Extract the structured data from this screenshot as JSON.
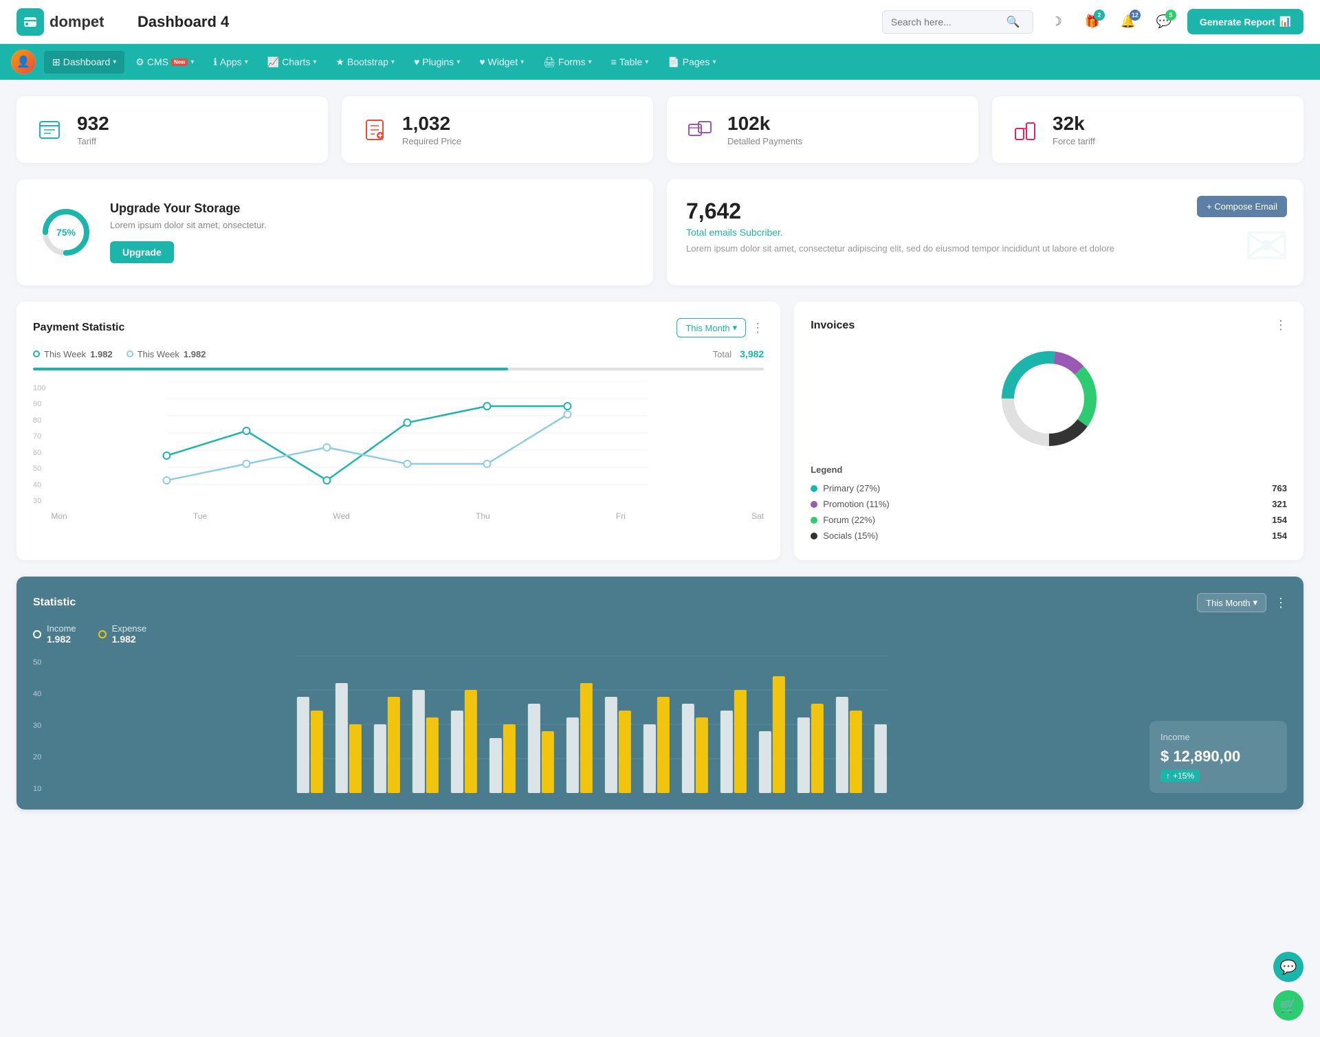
{
  "app": {
    "logo_letter": "c",
    "logo_name": "dompet",
    "page_title": "Dashboard 4",
    "search_placeholder": "Search here...",
    "generate_btn": "Generate Report"
  },
  "header_icons": {
    "moon_icon": "☽",
    "gift_icon": "🎁",
    "gift_badge": "2",
    "bell_icon": "🔔",
    "bell_badge": "12",
    "message_icon": "💬",
    "message_badge": "5"
  },
  "nav": {
    "items": [
      {
        "label": "Dashboard",
        "active": true,
        "has_arrow": true
      },
      {
        "label": "CMS",
        "has_badge_new": true,
        "has_arrow": true
      },
      {
        "label": "Apps",
        "has_arrow": true
      },
      {
        "label": "Charts",
        "has_arrow": true
      },
      {
        "label": "Bootstrap",
        "has_arrow": true
      },
      {
        "label": "Plugins",
        "has_arrow": true
      },
      {
        "label": "Widget",
        "has_arrow": true
      },
      {
        "label": "Forms",
        "has_arrow": true
      },
      {
        "label": "Table",
        "has_arrow": true
      },
      {
        "label": "Pages",
        "has_arrow": true
      }
    ]
  },
  "stat_cards": [
    {
      "number": "932",
      "label": "Tariff",
      "icon": "🗂️",
      "color": "#1cb5ac"
    },
    {
      "number": "1,032",
      "label": "Required Price",
      "icon": "📄",
      "color": "#e74c3c"
    },
    {
      "number": "102k",
      "label": "Detalled Payments",
      "icon": "🏪",
      "color": "#9b59b6"
    },
    {
      "number": "32k",
      "label": "Force tariff",
      "icon": "🏢",
      "color": "#e91e63"
    }
  ],
  "storage": {
    "percent": 75,
    "title": "Upgrade Your Storage",
    "description": "Lorem ipsum dolor sit amet, onsectetur.",
    "btn_label": "Upgrade",
    "donut_color": "#1cb5ac",
    "bg_color": "#e0e0e0"
  },
  "email": {
    "number": "7,642",
    "subtitle": "Total emails Subcriber.",
    "description": "Lorem ipsum dolor sit amet, consectetur adipiscing elit, sed do eiusmod tempor incididunt ut labore et dolore",
    "compose_btn": "+ Compose Email"
  },
  "payment_statistic": {
    "title": "Payment Statistic",
    "filter_label": "This Month",
    "dots_label": "⋮",
    "legend": [
      {
        "label": "This Week",
        "value": "1.982",
        "color": "#1cb5ac"
      },
      {
        "label": "This Week",
        "value": "1.982",
        "color": "#90cce8"
      }
    ],
    "total_label": "Total",
    "total_value": "3,982",
    "x_labels": [
      "Mon",
      "Tue",
      "Wed",
      "Thu",
      "Fri",
      "Sat"
    ],
    "y_labels": [
      "100",
      "90",
      "80",
      "70",
      "60",
      "50",
      "40",
      "30"
    ]
  },
  "invoices": {
    "title": "Invoices",
    "dots_label": "⋮",
    "legend_title": "Legend",
    "segments": [
      {
        "label": "Primary (27%)",
        "value": "763",
        "color": "#1cb5ac"
      },
      {
        "label": "Promotion (11%)",
        "value": "321",
        "color": "#9b59b6"
      },
      {
        "label": "Forum (22%)",
        "value": "154",
        "color": "#2ecc71"
      },
      {
        "label": "Socials (15%)",
        "value": "154",
        "color": "#333"
      }
    ]
  },
  "statistic": {
    "title": "Statistic",
    "filter_label": "This Month",
    "y_labels": [
      "50",
      "40",
      "30",
      "20",
      "10"
    ],
    "income": {
      "label": "Income",
      "value": "1.982",
      "color": "#ffffff"
    },
    "expense": {
      "label": "Expense",
      "value": "1.982",
      "color": "#f1c40f"
    },
    "income_detail": {
      "title": "Income",
      "amount": "$ 12,890,00",
      "badge": "+15%"
    }
  },
  "fab": {
    "support_icon": "💬",
    "cart_icon": "🛒"
  }
}
